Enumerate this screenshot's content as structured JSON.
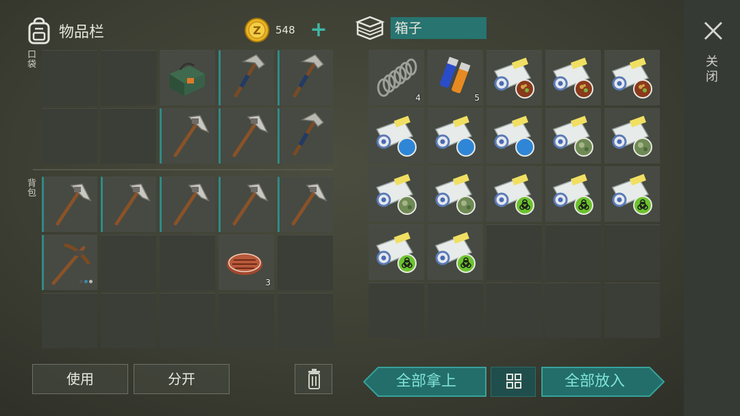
{
  "inventory": {
    "title": "物品栏",
    "pockets_label": "口袋",
    "backpack_label": "背包",
    "coins": "548",
    "pocket_slots": [
      {
        "item": ""
      },
      {
        "item": ""
      },
      {
        "item": "explosive-pack"
      },
      {
        "item": "hammer"
      },
      {
        "item": "hammer"
      },
      {
        "item": ""
      },
      {
        "item": ""
      },
      {
        "item": "stone-pickaxe"
      },
      {
        "item": "stone-pickaxe"
      },
      {
        "item": "hammer"
      }
    ],
    "backpack_slots": [
      {
        "item": "stone-pickaxe"
      },
      {
        "item": "stone-pickaxe"
      },
      {
        "item": "stone-pickaxe"
      },
      {
        "item": "stone-pickaxe"
      },
      {
        "item": "stone-pickaxe"
      },
      {
        "item": "wood-pickaxe"
      },
      {
        "item": ""
      },
      {
        "item": ""
      },
      {
        "item": "steak",
        "count": "3"
      },
      {
        "item": ""
      },
      {
        "item": ""
      },
      {
        "item": ""
      },
      {
        "item": ""
      },
      {
        "item": ""
      },
      {
        "item": ""
      }
    ],
    "use_button": "使用",
    "split_button": "分开"
  },
  "box": {
    "title": "箱子",
    "slots": [
      {
        "item": "spring",
        "count": "4"
      },
      {
        "item": "batteries",
        "count": "5"
      },
      {
        "item": "blueprint-meat"
      },
      {
        "item": "blueprint-meat"
      },
      {
        "item": "blueprint-meat"
      },
      {
        "item": "blueprint-blue"
      },
      {
        "item": "blueprint-blue"
      },
      {
        "item": "blueprint-blue"
      },
      {
        "item": "blueprint-camo"
      },
      {
        "item": "blueprint-camo"
      },
      {
        "item": "blueprint-camo"
      },
      {
        "item": "blueprint-camo"
      },
      {
        "item": "blueprint-bio"
      },
      {
        "item": "blueprint-bio"
      },
      {
        "item": "blueprint-bio"
      },
      {
        "item": "blueprint-bio"
      },
      {
        "item": "blueprint-bio"
      },
      {
        "item": ""
      },
      {
        "item": ""
      },
      {
        "item": ""
      },
      {
        "item": ""
      },
      {
        "item": ""
      },
      {
        "item": ""
      },
      {
        "item": ""
      },
      {
        "item": ""
      }
    ],
    "take_all_button": "全部拿上",
    "put_all_button": "全部放入"
  },
  "close_label": "关闭",
  "colors": {
    "accent": "#3fb6a4",
    "teal_dark": "#277470",
    "coin": "#e8b421"
  },
  "icons": [
    "backpack-icon",
    "coin-icon",
    "plus-icon",
    "box-icon",
    "close-icon",
    "trash-icon",
    "grid-icon"
  ]
}
